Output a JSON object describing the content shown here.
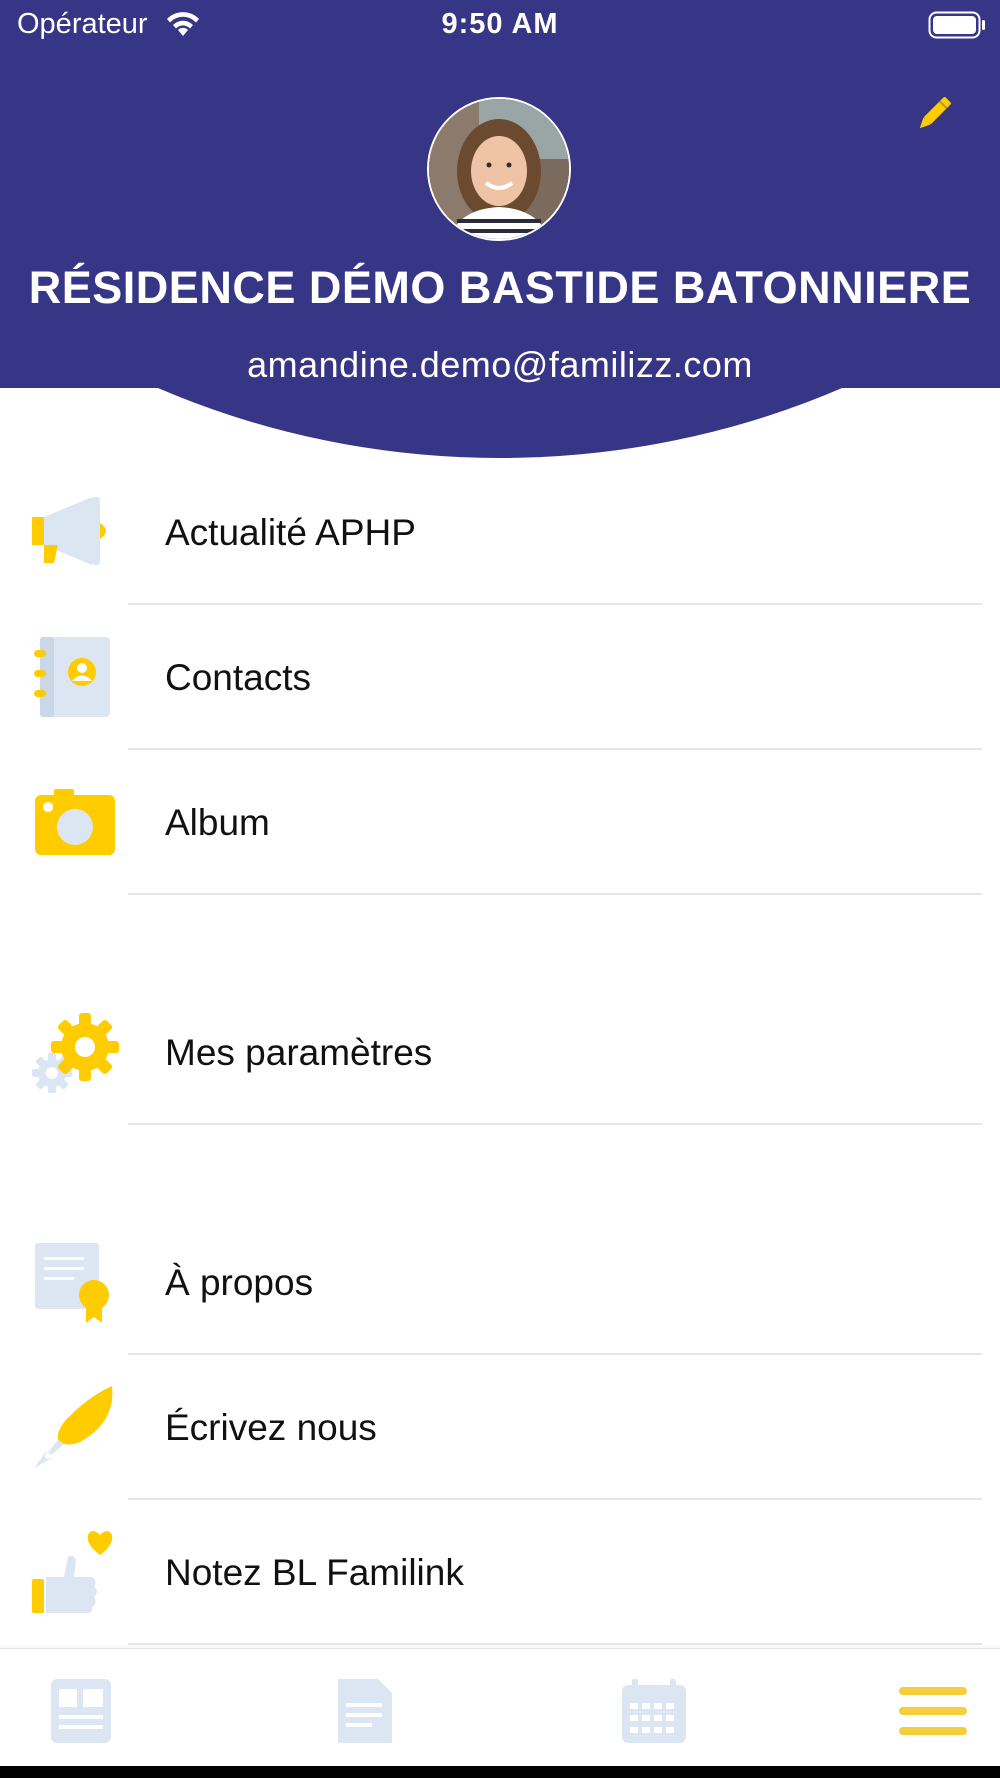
{
  "status_bar": {
    "carrier": "Opérateur",
    "time": "9:50 AM"
  },
  "header": {
    "residence_name": "RÉSIDENCE DÉMO BASTIDE BATONNIERE",
    "email": "amandine.demo@familizz.com",
    "background_color": "#373585"
  },
  "menu": {
    "items": [
      {
        "label": "Actualité APHP",
        "icon": "megaphone-icon"
      },
      {
        "label": "Contacts",
        "icon": "address-book-icon"
      },
      {
        "label": "Album",
        "icon": "camera-icon"
      },
      {
        "label": "Mes paramètres",
        "icon": "gears-icon"
      },
      {
        "label": "À propos",
        "icon": "certificate-icon"
      },
      {
        "label": "Écrivez nous",
        "icon": "quill-pen-icon"
      },
      {
        "label": "Notez BL Familink",
        "icon": "thumbs-up-heart-icon"
      }
    ]
  },
  "tabbar": {
    "tabs": [
      {
        "icon": "news-icon",
        "active": false
      },
      {
        "icon": "document-icon",
        "active": false
      },
      {
        "icon": "calendar-icon",
        "active": false
      },
      {
        "icon": "menu-icon",
        "active": true
      }
    ]
  },
  "colors": {
    "accent": "#FFCC00",
    "icon_light": "#DCE6F2",
    "header": "#373585"
  }
}
